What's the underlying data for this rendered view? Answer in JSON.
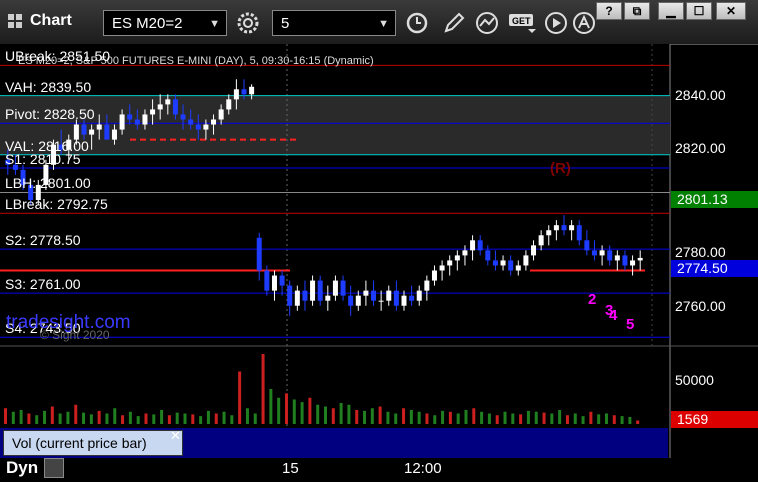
{
  "window": {
    "title": "Chart",
    "symbol": "ES M20=2",
    "interval": "5",
    "controls": [
      "?",
      "restore",
      "minimize",
      "maximize",
      "close"
    ]
  },
  "chart_header": "ES M20=2, S&P 500 FUTURES E-MINI (DAY), 5, 09:30-16:15 (Dynamic)",
  "levels": [
    {
      "label": "UBreak: 2851.50",
      "value": 2851.5,
      "color": "#c00000"
    },
    {
      "label": "VAH: 2839.50",
      "value": 2839.5,
      "color": "#00cccc"
    },
    {
      "label": "Pivot: 2828.50",
      "value": 2828.5,
      "color": "#0000ee"
    },
    {
      "label": "VAL: 2816.00",
      "value": 2816.0,
      "color": "#00cccc"
    },
    {
      "label": "S1: 2810.75",
      "value": 2810.75,
      "color": "#0000ee"
    },
    {
      "label": "LBH: 2801.00",
      "value": 2801.0,
      "color": "#888888"
    },
    {
      "label": "LBreak: 2792.75",
      "value": 2792.75,
      "color": "#c00000"
    },
    {
      "label": "S2: 2778.50",
      "value": 2778.5,
      "color": "#0000ee"
    },
    {
      "label": "S3: 2761.00",
      "value": 2761.0,
      "color": "#0000ee"
    },
    {
      "label": "S4: 2743.50",
      "value": 2743.5,
      "color": "#0000ee"
    }
  ],
  "price_axis": {
    "ticks": [
      "2840.00",
      "2820.00",
      "2780.00",
      "2760.00"
    ],
    "tags": [
      {
        "text": "2801.13",
        "color": "#008000"
      },
      {
        "text": "2774.50",
        "color": "#0000dd"
      }
    ]
  },
  "volume": {
    "label": "Vol (current price bar)",
    "tick": "50000",
    "tag": "1569",
    "tag_color": "#dd0000"
  },
  "x_axis": [
    "15",
    "12:00"
  ],
  "branding": {
    "text": "tradesight.com",
    "copyright": "© Sight 2020"
  },
  "sequence_marks": [
    "2",
    "3",
    "4",
    "5"
  ],
  "r_label": "(R)",
  "footer": {
    "mode": "Dyn"
  },
  "chart_data": {
    "type": "candlestick",
    "ylim": [
      2740,
      2860
    ],
    "candles": [
      [
        2814,
        2818,
        2808,
        2812
      ],
      [
        2812,
        2816,
        2808,
        2810
      ],
      [
        2810,
        2812,
        2802,
        2804
      ],
      [
        2804,
        2806,
        2796,
        2798
      ],
      [
        2798,
        2806,
        2796,
        2804
      ],
      [
        2804,
        2814,
        2802,
        2812
      ],
      [
        2812,
        2822,
        2810,
        2820
      ],
      [
        2820,
        2826,
        2816,
        2818
      ],
      [
        2818,
        2824,
        2814,
        2822
      ],
      [
        2822,
        2830,
        2820,
        2828
      ],
      [
        2828,
        2830,
        2822,
        2824
      ],
      [
        2824,
        2828,
        2818,
        2826
      ],
      [
        2826,
        2832,
        2822,
        2828
      ],
      [
        2828,
        2832,
        2824,
        2822
      ],
      [
        2822,
        2828,
        2820,
        2826
      ],
      [
        2826,
        2834,
        2824,
        2832
      ],
      [
        2832,
        2836,
        2828,
        2830
      ],
      [
        2830,
        2834,
        2826,
        2828
      ],
      [
        2828,
        2834,
        2826,
        2832
      ],
      [
        2832,
        2838,
        2828,
        2834
      ],
      [
        2834,
        2840,
        2830,
        2836
      ],
      [
        2836,
        2840,
        2832,
        2838
      ],
      [
        2838,
        2840,
        2830,
        2832
      ],
      [
        2832,
        2836,
        2826,
        2830
      ],
      [
        2830,
        2834,
        2826,
        2828
      ],
      [
        2828,
        2832,
        2822,
        2826
      ],
      [
        2826,
        2830,
        2822,
        2828
      ],
      [
        2828,
        2832,
        2824,
        2830
      ],
      [
        2830,
        2836,
        2828,
        2834
      ],
      [
        2834,
        2840,
        2832,
        2838
      ],
      [
        2838,
        2846,
        2834,
        2842
      ],
      [
        2842,
        2846,
        2838,
        2840
      ],
      [
        2840,
        2844,
        2838,
        2843
      ],
      [
        2783,
        2785,
        2766,
        2770
      ],
      [
        2770,
        2772,
        2760,
        2762
      ],
      [
        2762,
        2770,
        2758,
        2768
      ],
      [
        2768,
        2770,
        2760,
        2764
      ],
      [
        2764,
        2766,
        2752,
        2756
      ],
      [
        2756,
        2764,
        2754,
        2762
      ],
      [
        2762,
        2766,
        2754,
        2758
      ],
      [
        2758,
        2768,
        2756,
        2766
      ],
      [
        2766,
        2768,
        2756,
        2758
      ],
      [
        2758,
        2764,
        2754,
        2760
      ],
      [
        2760,
        2768,
        2758,
        2766
      ],
      [
        2766,
        2768,
        2758,
        2760
      ],
      [
        2760,
        2764,
        2752,
        2756
      ],
      [
        2756,
        2762,
        2754,
        2760
      ],
      [
        2760,
        2766,
        2756,
        2762
      ],
      [
        2762,
        2766,
        2756,
        2758
      ],
      [
        2758,
        2762,
        2754,
        2758
      ],
      [
        2758,
        2764,
        2756,
        2762
      ],
      [
        2762,
        2766,
        2754,
        2756
      ],
      [
        2756,
        2762,
        2754,
        2760
      ],
      [
        2760,
        2764,
        2756,
        2758
      ],
      [
        2758,
        2764,
        2756,
        2762
      ],
      [
        2762,
        2768,
        2758,
        2766
      ],
      [
        2766,
        2772,
        2764,
        2770
      ],
      [
        2770,
        2774,
        2766,
        2772
      ],
      [
        2772,
        2776,
        2768,
        2774
      ],
      [
        2774,
        2778,
        2770,
        2776
      ],
      [
        2776,
        2780,
        2772,
        2778
      ],
      [
        2778,
        2784,
        2774,
        2782
      ],
      [
        2782,
        2784,
        2776,
        2778
      ],
      [
        2778,
        2780,
        2772,
        2774
      ],
      [
        2774,
        2778,
        2770,
        2772
      ],
      [
        2772,
        2776,
        2770,
        2774
      ],
      [
        2774,
        2776,
        2768,
        2770
      ],
      [
        2770,
        2774,
        2768,
        2772
      ],
      [
        2772,
        2778,
        2770,
        2776
      ],
      [
        2776,
        2782,
        2774,
        2780
      ],
      [
        2780,
        2786,
        2778,
        2784
      ],
      [
        2784,
        2788,
        2780,
        2786
      ],
      [
        2786,
        2790,
        2782,
        2788
      ],
      [
        2788,
        2792,
        2784,
        2786
      ],
      [
        2786,
        2790,
        2782,
        2788
      ],
      [
        2788,
        2790,
        2780,
        2782
      ],
      [
        2782,
        2786,
        2776,
        2778
      ],
      [
        2778,
        2782,
        2774,
        2776
      ],
      [
        2776,
        2780,
        2772,
        2778
      ],
      [
        2778,
        2780,
        2772,
        2774
      ],
      [
        2774,
        2778,
        2770,
        2776
      ],
      [
        2776,
        2778,
        2770,
        2772
      ],
      [
        2772,
        2776,
        2768,
        2774
      ],
      [
        2774,
        2778,
        2770,
        2775
      ]
    ],
    "volume": [
      18,
      14,
      16,
      12,
      10,
      15,
      20,
      12,
      14,
      22,
      13,
      11,
      15,
      12,
      18,
      10,
      14,
      9,
      12,
      11,
      16,
      10,
      13,
      12,
      11,
      9,
      15,
      12,
      14,
      10,
      60,
      18,
      12,
      80,
      40,
      30,
      35,
      28,
      25,
      30,
      22,
      20,
      18,
      24,
      22,
      16,
      15,
      18,
      20,
      14,
      12,
      18,
      16,
      14,
      12,
      10,
      15,
      14,
      12,
      16,
      18,
      14,
      12,
      10,
      14,
      12,
      11,
      15,
      14,
      13,
      12,
      16,
      10,
      12,
      9,
      14,
      11,
      12,
      10,
      9,
      8,
      4
    ]
  }
}
